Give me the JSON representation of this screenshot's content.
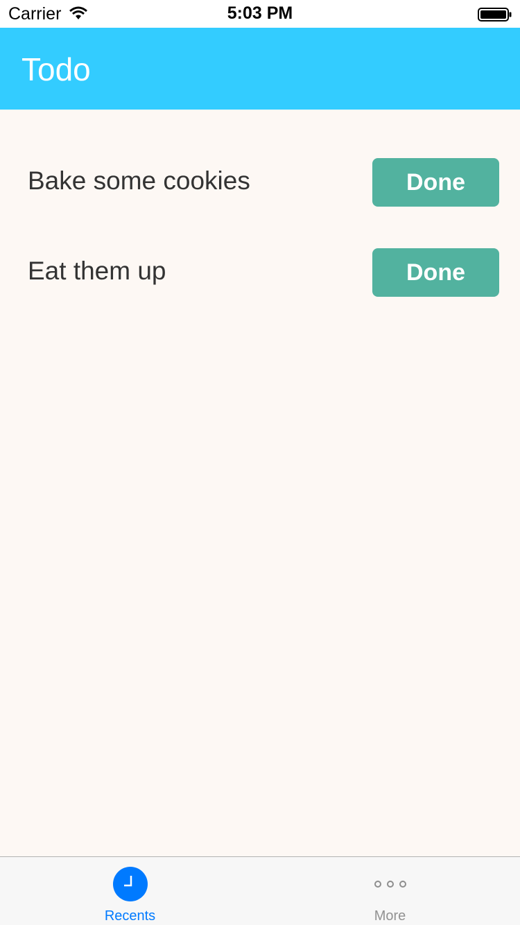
{
  "status_bar": {
    "carrier": "Carrier",
    "time": "5:03 PM",
    "wifi_icon": "wifi-icon",
    "battery_icon": "battery-full-icon"
  },
  "nav": {
    "title": "Todo",
    "background_color": "#33ccff"
  },
  "todos": [
    {
      "text": "Bake some cookies",
      "button_label": "Done"
    },
    {
      "text": "Eat them up",
      "button_label": "Done"
    }
  ],
  "colors": {
    "done_button": "#52b29f",
    "content_background": "#fdf8f4",
    "tab_active": "#007aff",
    "tab_inactive": "#929292"
  },
  "tab_bar": {
    "tabs": [
      {
        "label": "Recents",
        "icon": "clock-icon",
        "selected": true
      },
      {
        "label": "More",
        "icon": "more-dots-icon",
        "selected": false
      }
    ]
  }
}
